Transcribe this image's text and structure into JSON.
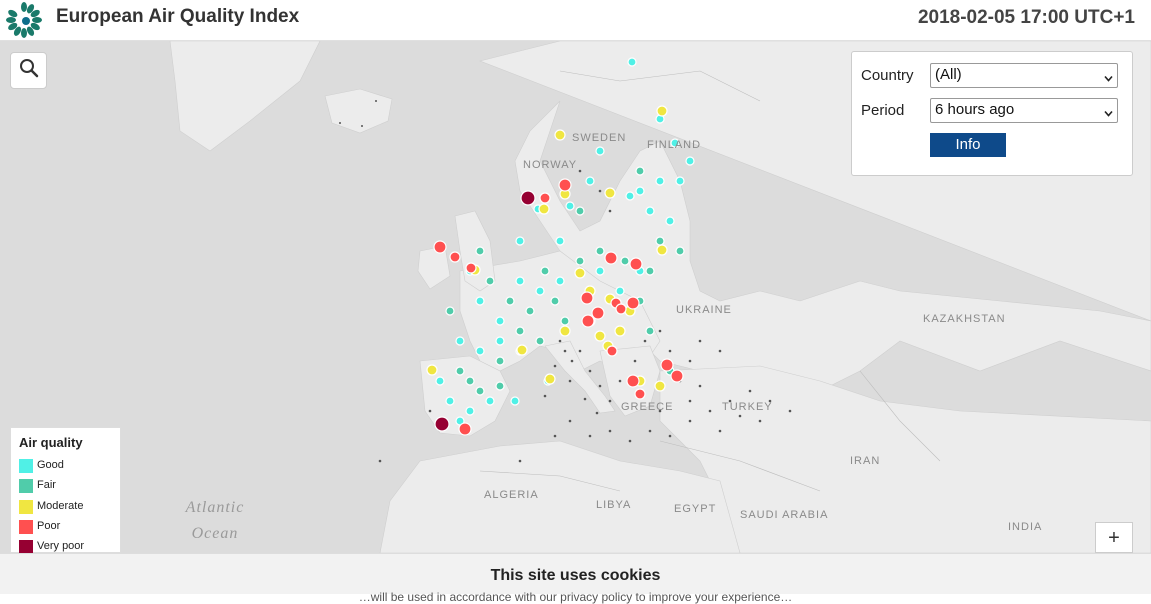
{
  "header": {
    "title": "European Air Quality Index",
    "timestamp": "2018-02-05 17:00 UTC+1"
  },
  "controls": {
    "country_label": "Country",
    "country_value": "(All)",
    "period_label": "Period",
    "period_value": "6 hours ago",
    "info_label": "Info",
    "zoom_in_label": "+"
  },
  "legend": {
    "title": "Air quality",
    "items": [
      {
        "label": "Good",
        "color": "#50f0e6"
      },
      {
        "label": "Fair",
        "color": "#50ccaa"
      },
      {
        "label": "Moderate",
        "color": "#f0e641"
      },
      {
        "label": "Poor",
        "color": "#ff5050"
      },
      {
        "label": "Very poor",
        "color": "#960032"
      }
    ]
  },
  "map_labels": {
    "sweden": "SWEDEN",
    "finland": "FINLAND",
    "norway": "NORWAY",
    "ukraine": "UKRAINE",
    "kazakhstan": "KAZAKHSTAN",
    "greece": "GREECE",
    "turkey": "TURKEY",
    "iran": "IRAN",
    "algeria": "ALGERIA",
    "libya": "LIBYA",
    "egypt": "EGYPT",
    "saudi_arabia": "SAUDI ARABIA",
    "india": "INDIA",
    "atlantic": "Atlantic",
    "ocean": "Ocean"
  },
  "icons": {
    "logo": "eea-logo",
    "search": "search-icon",
    "chevron": "chevron-down-icon"
  },
  "cookie_banner": {
    "title": "This site uses cookies",
    "text": "…will be used in accordance with our privacy policy to improve your experience…"
  },
  "colors": {
    "no_data": "#555555",
    "info_button": "#0e4a8a"
  }
}
